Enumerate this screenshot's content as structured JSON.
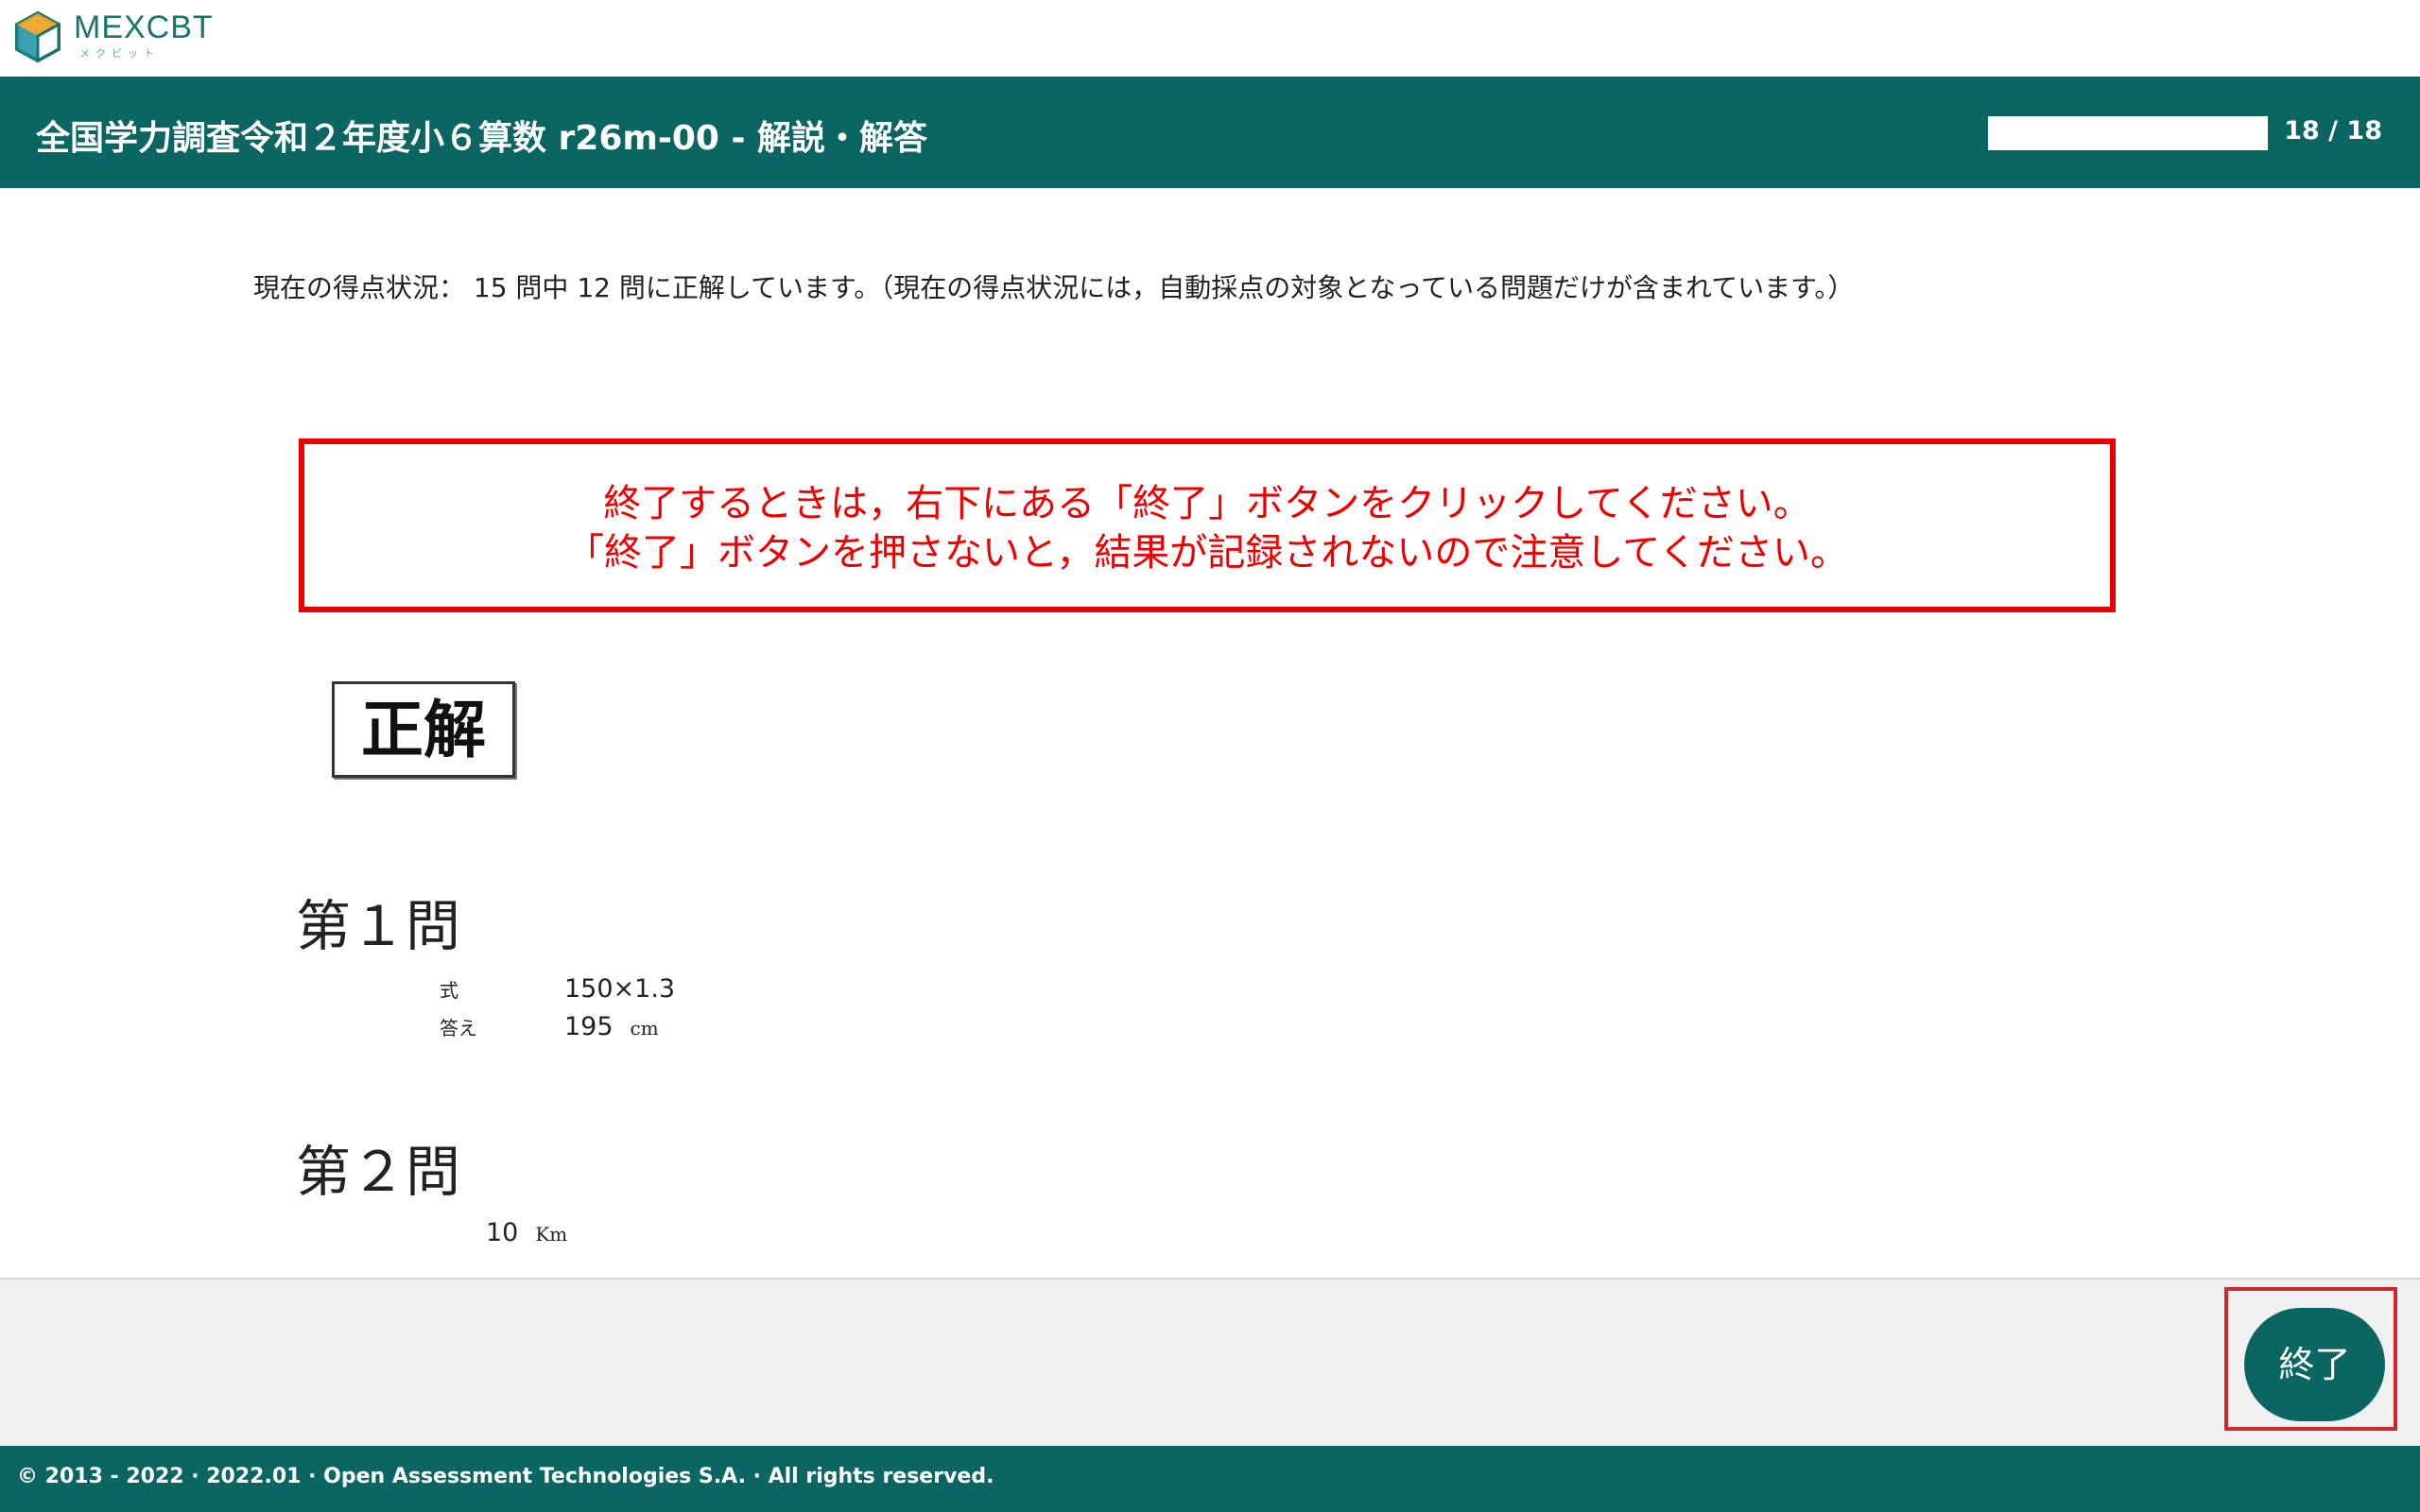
{
  "brand": {
    "name": "MEXCBT",
    "subtitle": "メクビット",
    "accent_color": "#0b6663"
  },
  "header": {
    "title": "全国学力調査令和２年度小６算数 r26m-00 - 解説・解答",
    "progress_fraction": 1.0,
    "page_counter": "18 / 18"
  },
  "content": {
    "score_status": "現在の得点状況： 15 問中 12 問に正解しています。（現在の得点状況には，自動採点の対象となっている問題だけが含まれています。）",
    "notice": {
      "line1": "終了するときは，右下にある「終了」ボタンをクリックしてください。",
      "line2": "「終了」ボタンを押さないと，結果が記録されないので注意してください。",
      "color": "#ee0000"
    },
    "result_badge": "正解",
    "questions": [
      {
        "title": "第１問",
        "formula_label": "式",
        "formula": "150×1.3",
        "answer_label": "答え",
        "answer": "195",
        "unit": "cm"
      },
      {
        "title": "第２問",
        "answer": "10",
        "unit": "Km"
      }
    ]
  },
  "actions": {
    "end_button_label": "終了",
    "highlight_color": "#d0282d"
  },
  "footer": {
    "text": "© 2013 - 2022 · 2022.01 · Open Assessment Technologies S.A. · All rights reserved."
  }
}
